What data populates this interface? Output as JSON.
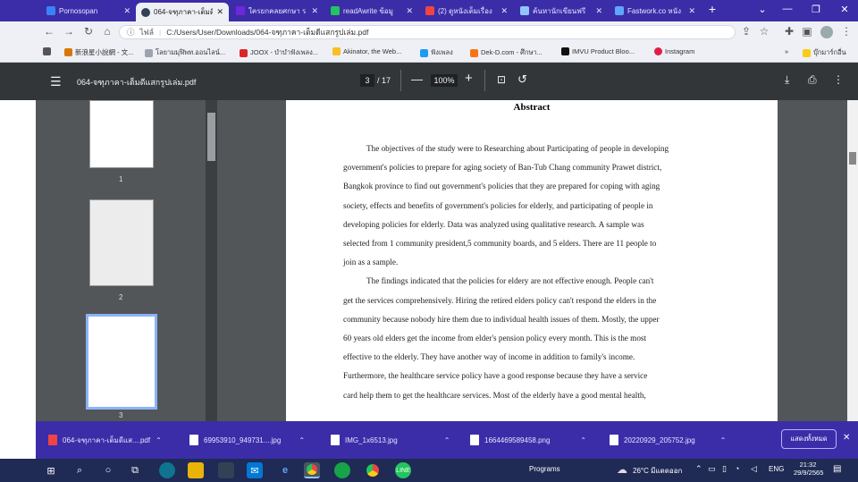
{
  "tabs": [
    {
      "label": "Pornosopan",
      "color": "#3b82f6"
    },
    {
      "label": "064-จฑุภาคา-เต็มดี",
      "color": "#ffffff",
      "active": true
    },
    {
      "label": "ใครยกคลยศกษา ร",
      "color": "#6d28d9"
    },
    {
      "label": "readAwrite ข้อมู",
      "color": "#22c55e"
    },
    {
      "label": "(2) ดูหนังเต็มเรื่อง",
      "color": "#ef4444"
    },
    {
      "label": "ค้นหานักเขียนฟรี",
      "color": "#93c5fd"
    },
    {
      "label": "Fastwork.co หนัง",
      "color": "#60a5fa"
    }
  ],
  "address": {
    "info": "ไฟล์",
    "url": "C:/Users/User/Downloads/064-จฑุภาคา-เต็มดีแสกรูปเล่ม.pdf"
  },
  "bookmarks": [
    {
      "label": "新浪星小說網 - 文..."
    },
    {
      "label": "โลยามมุฬิพท.ออนไลน์..."
    },
    {
      "label": "JOOX - บำบำฟังเพลง..."
    },
    {
      "label": "Akinator, the Web..."
    },
    {
      "label": "ฟังเพลง"
    },
    {
      "label": "Dek-D.com - ศึกษา..."
    },
    {
      "label": "IMVU Product Bloo..."
    },
    {
      "label": "Instagram"
    }
  ],
  "bookmarks_other": "บุ๊กมาร์กอื่น",
  "pdf": {
    "filename": "064-จฑุภาคา-เต็มดีแสกรูปเล่ม.pdf",
    "page": "3",
    "total": "/ 17",
    "zoom": "100%"
  },
  "thumbs": [
    {
      "num": "1"
    },
    {
      "num": "2"
    },
    {
      "num": "3"
    }
  ],
  "doc": {
    "heading": "Abstract",
    "lines": [
      "The objectives of the study were to Researching about Participating of people in developing",
      "government's policies to prepare for aging society of Ban-Tub Chang community Prawet district,",
      "Bangkok province to find out government's policies that they are prepared for coping with aging",
      "society, effects and benefits of government's policies for elderly, and participating of people in",
      "developing policies for elderly. Data was analyzed using qualitative research. A sample was",
      "selected from 1 community president,5 community boards, and 5 elders. There are 11 people to",
      "join as a sample.",
      "The findings indicated that the policies for eldery are not effective enough. People can't",
      "get the services comprehensively. Hiring the retired elders policy can't respond the elders in the",
      "community because nobody hire them due to individual health issues of them. Mostly, the upper",
      "60 years old elders get the income from elder's pension policy every month. This is the most",
      "effective to the elderly. They have another way of income in addition to family's income.",
      "Furthermore, the healthcare service policy have a good response because they have a service",
      "card help them to get the healthcare services. Most of the elderly have a good mental health,"
    ]
  },
  "downloads": [
    {
      "label": "064-จฑุภาคา-เต็มดีแส....pdf",
      "color": "#ef4444"
    },
    {
      "label": "69953910_949731....jpg",
      "color": "#ffffff"
    },
    {
      "label": "IMG_1x6513.jpg",
      "color": "#ffffff"
    },
    {
      "label": "1664469589458.png",
      "color": "#ffffff"
    },
    {
      "label": "20220929_205752.jpg",
      "color": "#ffffff"
    }
  ],
  "downloads_showall": "แสดงทั้งหมด",
  "taskbar": {
    "search": "Programs",
    "weather": "26°C มีแดดออก",
    "lang": "ENG",
    "time": "21:32",
    "date": "29/9/2565"
  }
}
